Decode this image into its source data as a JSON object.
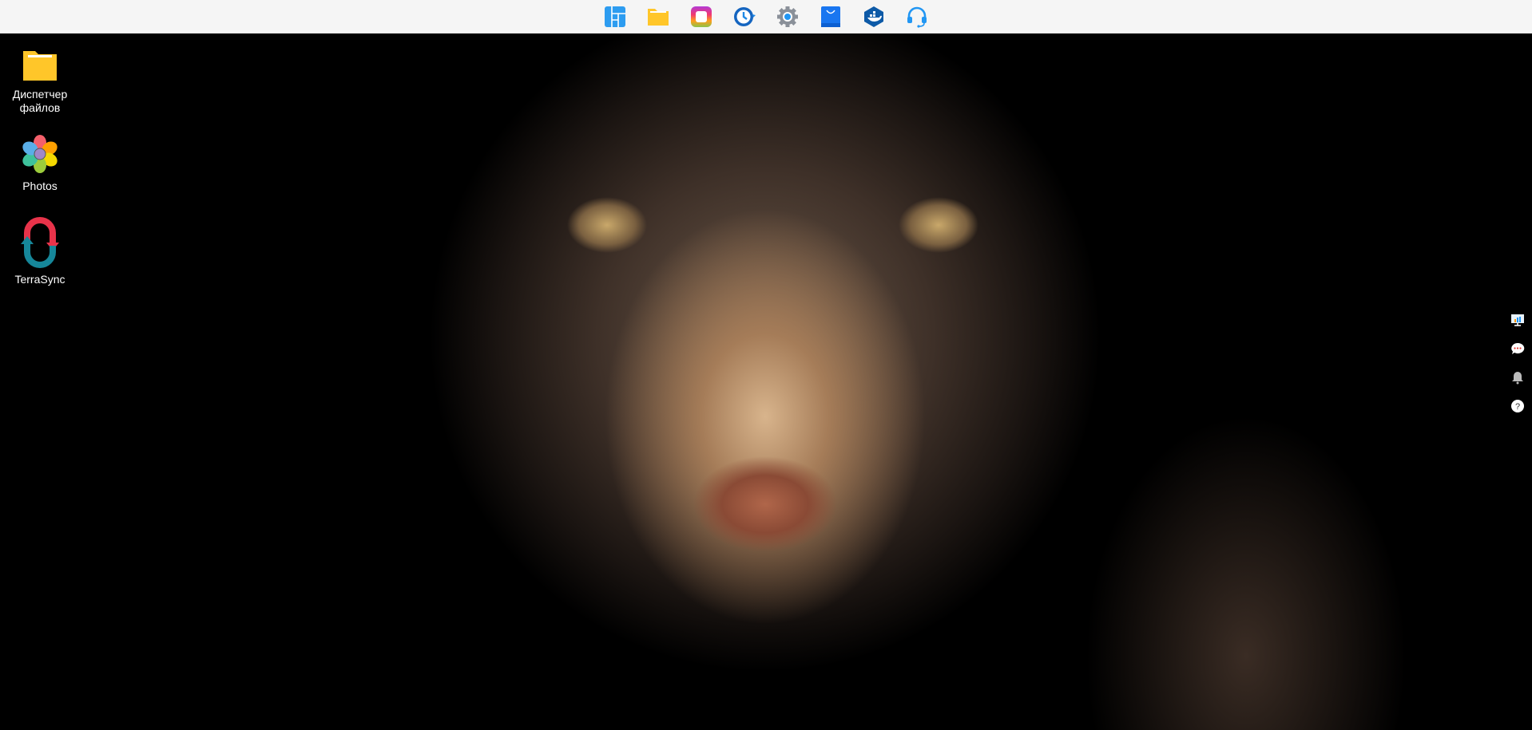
{
  "taskbar": {
    "apps": [
      {
        "name": "main-menu",
        "icon": "grid-panels-icon"
      },
      {
        "name": "file-manager",
        "icon": "folder-icon"
      },
      {
        "name": "photos",
        "icon": "gradient-square-icon"
      },
      {
        "name": "backup",
        "icon": "clock-refresh-icon"
      },
      {
        "name": "settings",
        "icon": "gear-icon"
      },
      {
        "name": "app-center",
        "icon": "shopping-bag-icon"
      },
      {
        "name": "docker",
        "icon": "docker-icon"
      },
      {
        "name": "support",
        "icon": "headset-icon"
      }
    ]
  },
  "desktop": {
    "icons": [
      {
        "label": "Диспетчер файлов",
        "icon": "folder-icon"
      },
      {
        "label": "Photos",
        "icon": "flower-icon"
      },
      {
        "label": "TerraSync",
        "icon": "sync-icon"
      }
    ]
  },
  "colors": {
    "accent": "#2196f3",
    "folder": "#ffc629",
    "topbar": "#f5f5f5"
  }
}
